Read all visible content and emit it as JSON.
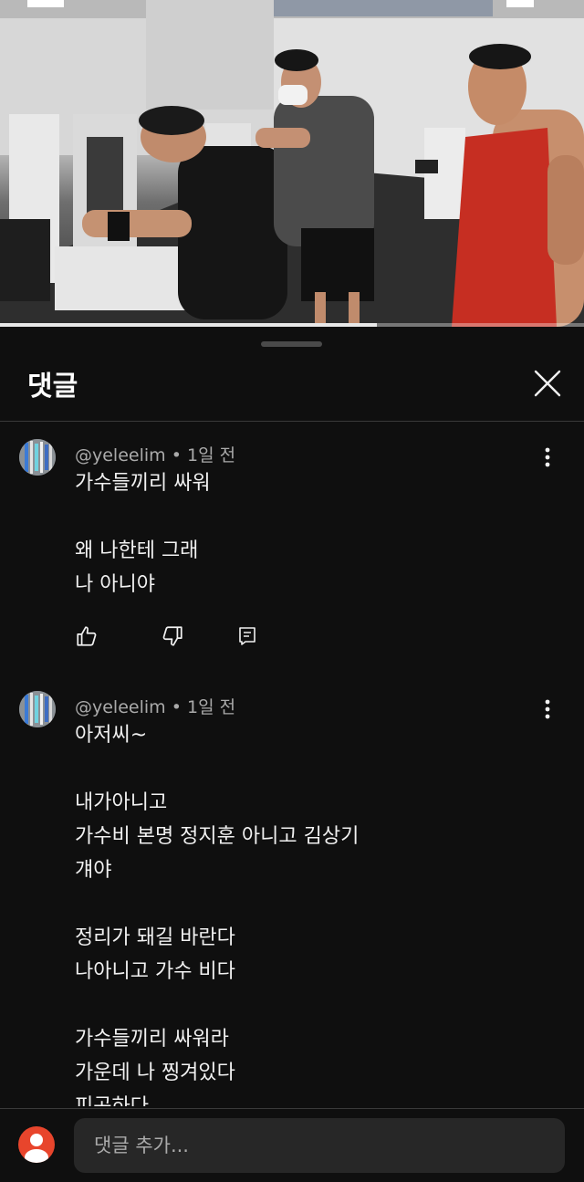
{
  "video": {
    "progress_fraction": 0.645
  },
  "panel": {
    "title": "댓글"
  },
  "comments": [
    {
      "author": "@yeleelim",
      "separator": "•",
      "time": "1일 전",
      "text": "가수들끼리 싸워\n\n왜 나한테 그래\n나 아니야"
    },
    {
      "author": "@yeleelim",
      "separator": "•",
      "time": "1일 전",
      "text": "아저씨~\n\n내가아니고\n가수비 본명 정지훈 아니고 김상기\n걔야\n\n정리가 돼길 바란다\n나아니고 가수 비다\n\n가수들끼리 싸워라\n가운데 나 찡겨있다\n피곤하다"
    }
  ],
  "icons": {
    "close": "close-icon",
    "more": "more-vert-icon",
    "like": "thumb-up-icon",
    "dislike": "thumb-down-icon",
    "reply": "reply-icon"
  },
  "composer": {
    "placeholder": "댓글 추가..."
  },
  "colors": {
    "background": "#0f0f0f",
    "user_avatar": "#e8452c"
  }
}
